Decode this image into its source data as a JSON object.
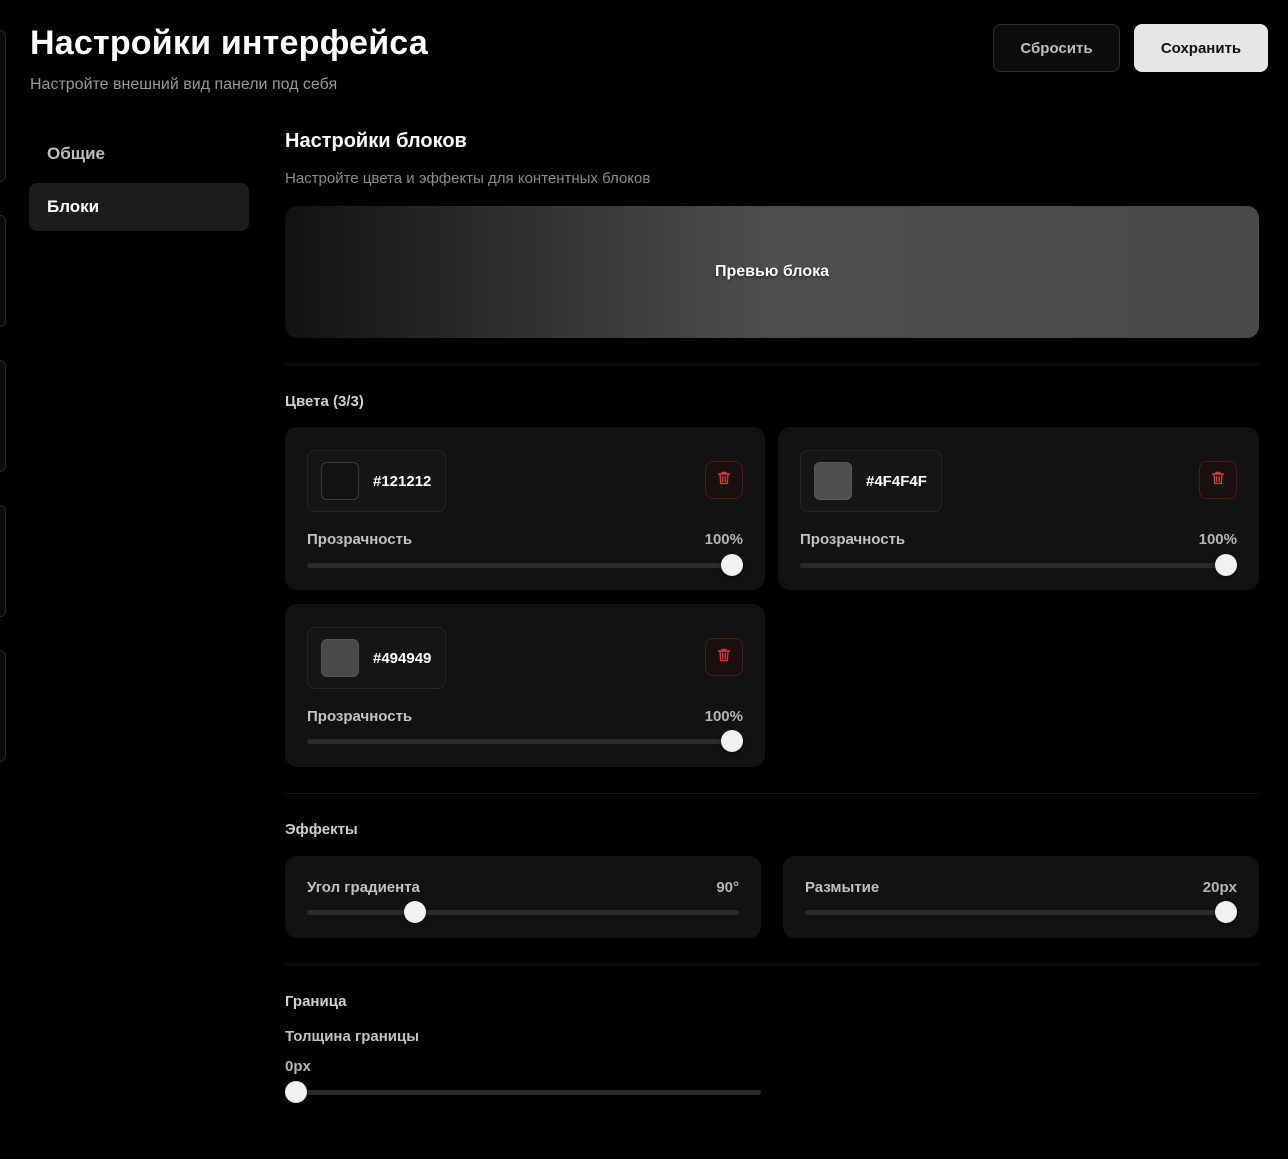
{
  "header": {
    "title": "Настройки интерфейса",
    "subtitle": "Настройте внешний вид панели под себя",
    "reset_label": "Сбросить",
    "save_label": "Сохранить"
  },
  "sidebar": {
    "items": [
      {
        "label": "Общие",
        "active": false
      },
      {
        "label": "Блоки",
        "active": true
      }
    ]
  },
  "main": {
    "title": "Настройки блоков",
    "description": "Настройте цвета и эффекты для контентных блоков",
    "preview_label": "Превью блока",
    "colors": {
      "label": "Цвета (3/3)",
      "items": [
        {
          "hex": "#121212",
          "opacity_label": "Прозрачность",
          "opacity_value": "100%",
          "opacity": 1.0
        },
        {
          "hex": "#4F4F4F",
          "opacity_label": "Прозрачность",
          "opacity_value": "100%",
          "opacity": 1.0
        },
        {
          "hex": "#494949",
          "opacity_label": "Прозрачность",
          "opacity_value": "100%",
          "opacity": 1.0
        }
      ]
    },
    "effects": {
      "label": "Эффекты",
      "gradient_angle": {
        "label": "Угол градиента",
        "value": "90°",
        "level": 0.25
      },
      "blur": {
        "label": "Размытие",
        "value": "20px",
        "level": 1.0
      }
    },
    "border": {
      "label": "Граница",
      "thickness_label": "Толщина границы",
      "thickness_value": "0px",
      "level": 0.0
    }
  },
  "icons": {
    "delete": "trash-icon"
  },
  "colors": {
    "danger": "#d23b3b",
    "background": "#000000",
    "card": "#121212"
  }
}
